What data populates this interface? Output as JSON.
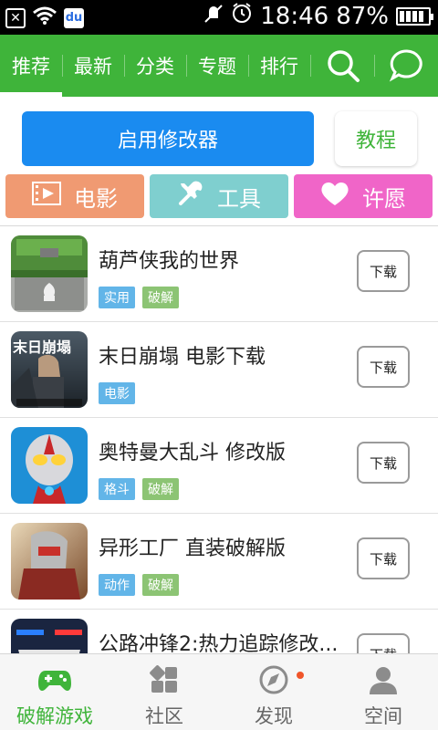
{
  "status_bar": {
    "time": "18:46",
    "battery_pct": "87%",
    "baidu_glyph": "du"
  },
  "top_tabs": [
    "推荐",
    "最新",
    "分类",
    "专题",
    "排行"
  ],
  "top_icons": [
    "search-icon",
    "chat-bubble-icon"
  ],
  "actions": {
    "enable_modifier": "启用修改器",
    "tutorial": "教程"
  },
  "categories": [
    {
      "label": "电影",
      "icon": "film-icon",
      "color": "#f09a72"
    },
    {
      "label": "工具",
      "icon": "tools-icon",
      "color": "#7fcfcf"
    },
    {
      "label": "许愿",
      "icon": "heart-icon",
      "color": "#f065c8"
    }
  ],
  "games": [
    {
      "title": "葫芦侠我的世界",
      "tags": [
        "实用",
        "破解"
      ],
      "download": "下载",
      "icon": "minecraft-chest-icon"
    },
    {
      "title": "末日崩塌 电影下载",
      "tags": [
        "电影"
      ],
      "download": "下载",
      "icon": "san-andreas-poster-icon"
    },
    {
      "title": "奥特曼大乱斗 修改版",
      "tags": [
        "格斗",
        "破解"
      ],
      "download": "下载",
      "icon": "ultraman-icon"
    },
    {
      "title": "异形工厂 直装破解版",
      "tags": [
        "动作",
        "破解"
      ],
      "download": "下载",
      "icon": "robot-mech-icon"
    },
    {
      "title": "公路冲锋2:热力追踪修改...",
      "tags": [],
      "download": "下载",
      "icon": "police-car-icon"
    }
  ],
  "thumb_texts": {
    "poster_title": "末日崩塌"
  },
  "bottom_nav": [
    {
      "label": "破解游戏",
      "icon": "gamepad-icon",
      "active": true
    },
    {
      "label": "社区",
      "icon": "community-grid-icon",
      "active": false
    },
    {
      "label": "发现",
      "icon": "compass-icon",
      "active": false
    },
    {
      "label": "空间",
      "icon": "user-profile-icon",
      "active": false
    }
  ],
  "colors": {
    "brand_green": "#3fb43a",
    "primary_blue": "#1a8bf0",
    "tag_blue": "#62b5e8",
    "tag_green": "#8cc474"
  }
}
